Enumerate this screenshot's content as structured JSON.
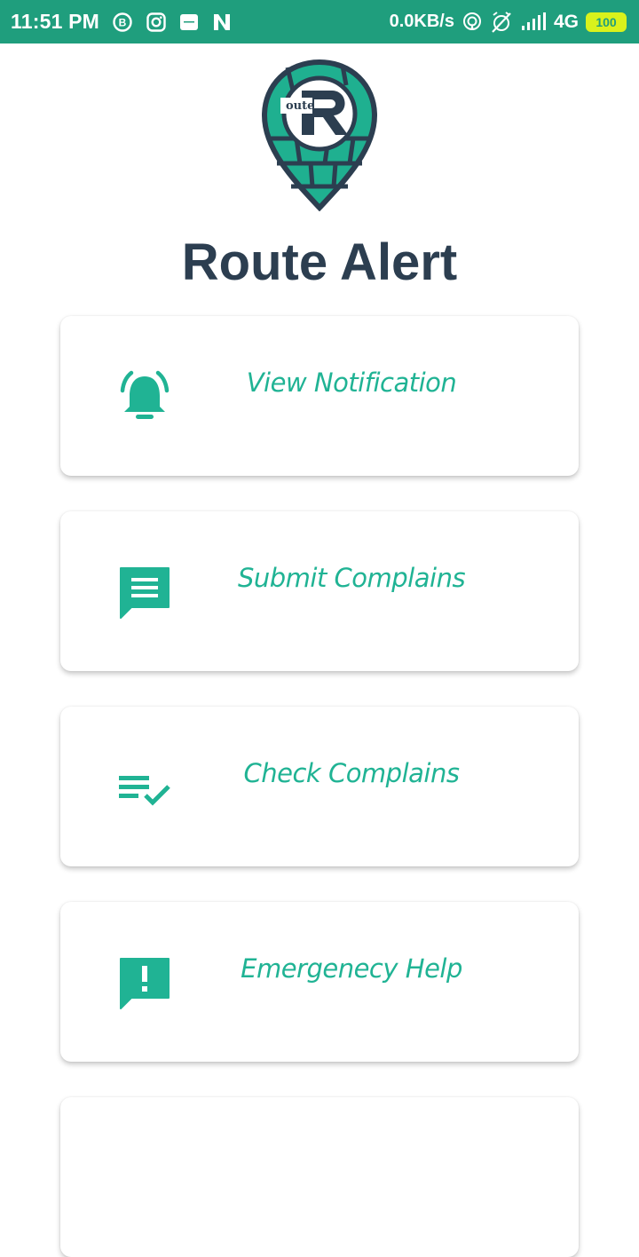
{
  "status_bar": {
    "time": "11:51 PM",
    "left_icons": [
      "b-notification-icon",
      "instagram-icon",
      "news-icon",
      "n-notification-icon"
    ],
    "network_speed": "0.0KB/s",
    "network_type": "4G",
    "battery": "100",
    "colors": {
      "background": "#1f9e7d",
      "battery": "#d9f21c"
    }
  },
  "app": {
    "title": "Route Alert",
    "logo_text": "oute"
  },
  "menu": [
    {
      "label": "View Notification",
      "icon": "bell-alarm-icon"
    },
    {
      "label": "Submit Complains",
      "icon": "message-text-icon"
    },
    {
      "label": "Check Complains",
      "icon": "checklist-icon"
    },
    {
      "label": "Emergenecy Help",
      "icon": "alert-message-icon"
    }
  ],
  "colors": {
    "accent": "#20b394",
    "title": "#2c3e50"
  }
}
